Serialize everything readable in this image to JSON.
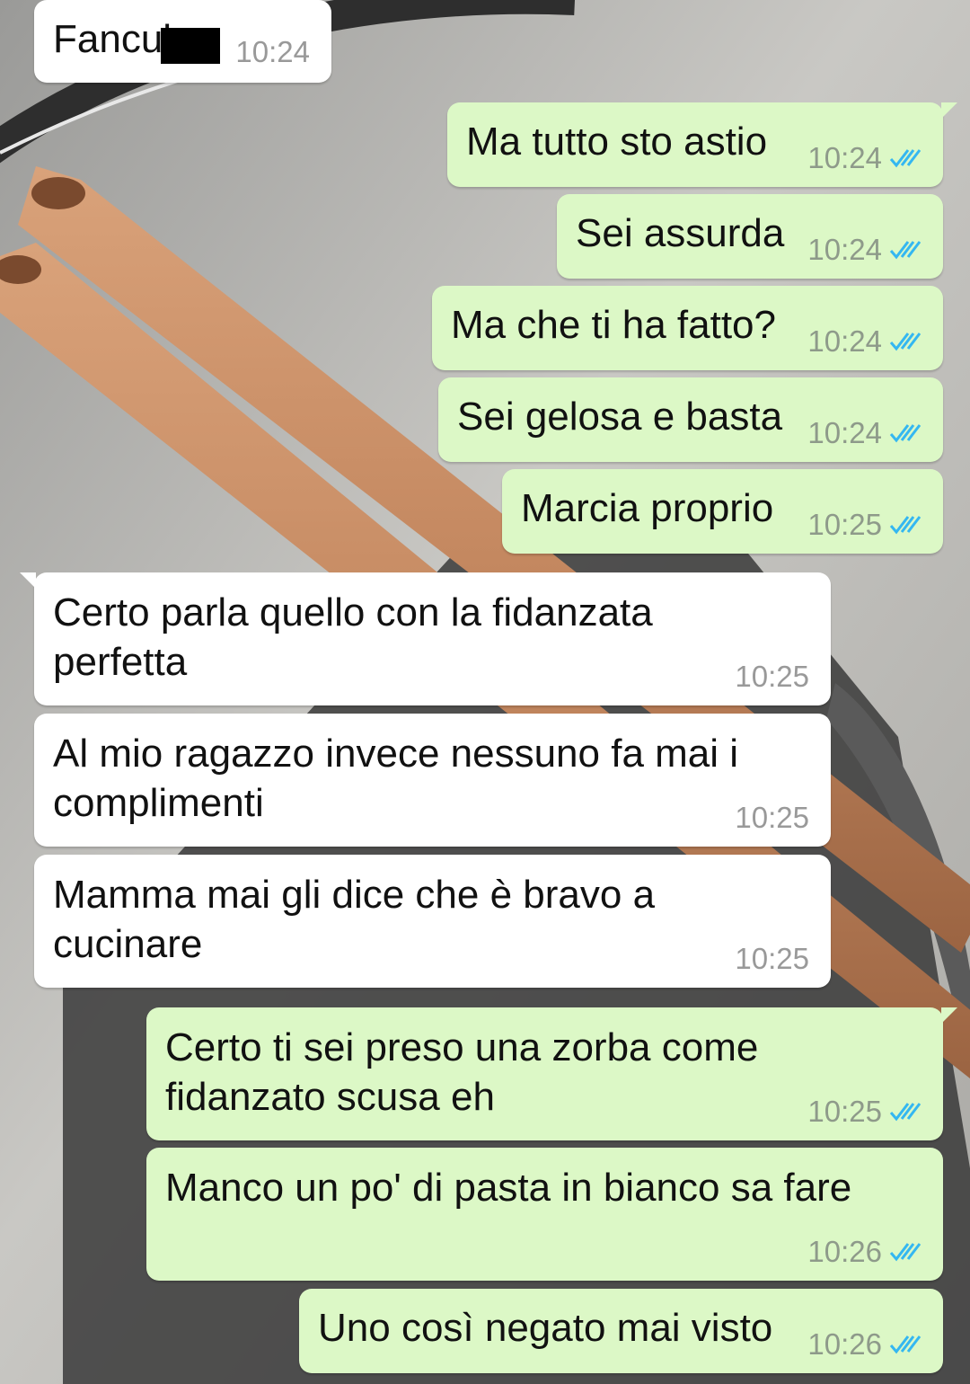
{
  "colors": {
    "incoming_bubble": "#ffffff",
    "outgoing_bubble": "#dcf8c6",
    "read_ticks": "#34b7f1",
    "timestamp": "#8e9a8a"
  },
  "messages": [
    {
      "direction": "in",
      "text": "Fanculo",
      "time": "10:24"
    },
    {
      "direction": "out",
      "text": "Ma tutto sto astio",
      "time": "10:24",
      "status": "read"
    },
    {
      "direction": "out",
      "text": "Sei assurda",
      "time": "10:24",
      "status": "read"
    },
    {
      "direction": "out",
      "text": "Ma che ti ha fatto?",
      "time": "10:24",
      "status": "read"
    },
    {
      "direction": "out",
      "text": "Sei gelosa e basta",
      "time": "10:24",
      "status": "read"
    },
    {
      "direction": "out",
      "text": "Marcia proprio",
      "time": "10:25",
      "status": "read"
    },
    {
      "direction": "in",
      "lines": [
        "Certo parla quello con la fidanzata",
        "perfetta"
      ],
      "time": "10:25"
    },
    {
      "direction": "in",
      "lines": [
        "Al mio ragazzo invece nessuno fa mai i",
        "complimenti"
      ],
      "time": "10:25"
    },
    {
      "direction": "in",
      "lines": [
        "Mamma mai gli dice che è bravo a",
        "cucinare"
      ],
      "time": "10:25"
    },
    {
      "direction": "out",
      "lines": [
        "Certo ti sei preso una zorba come",
        "fidanzato scusa eh"
      ],
      "time": "10:25",
      "status": "read"
    },
    {
      "direction": "out",
      "text": "Manco un po' di pasta in bianco sa fare",
      "time": "10:26",
      "status": "read"
    },
    {
      "direction": "out",
      "text": "Uno così negato mai visto",
      "time": "10:26",
      "status": "read"
    }
  ]
}
